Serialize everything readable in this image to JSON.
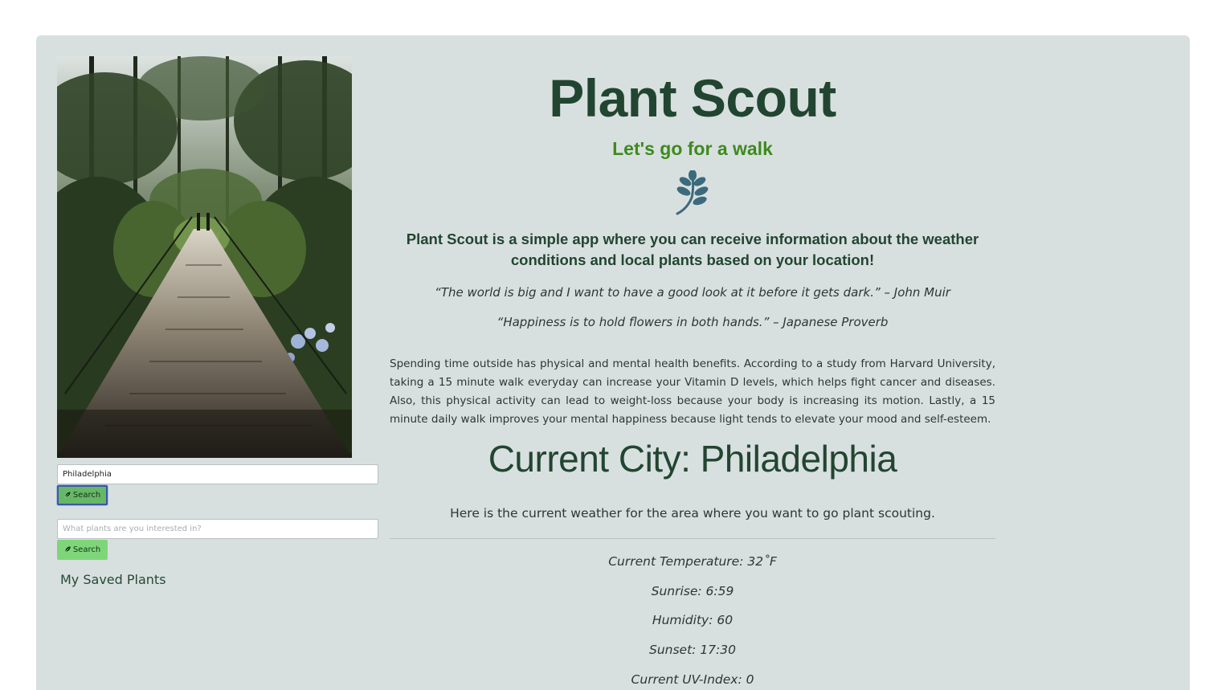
{
  "app": {
    "title": "Plant Scout",
    "tagline": "Let's go for a walk",
    "logo_icon": "leaf-branch-icon",
    "intro": "Plant Scout is a simple app where you can receive information about the weather conditions and local plants based on your location!"
  },
  "quotes": [
    "“The world is big and I want to have a good look at it before it gets dark.” – John Muir",
    "“Happiness is to hold flowers in both hands.” – Japanese Proverb"
  ],
  "health_text": "Spending time outside has physical and mental health benefits. According to a study from Harvard University, taking a 15 minute walk everyday can increase your Vitamin D levels, which helps fight cancer and diseases. Also, this physical activity can lead to weight-loss because your body is increasing its motion. Lastly, a 15 minute daily walk improves your mental happiness because light tends to elevate your mood and self-esteem.",
  "sidebar": {
    "city_search": {
      "value": "Philadelphia",
      "placeholder": "",
      "button_label": "Search",
      "button_icon": "leaf-icon"
    },
    "plant_search": {
      "value": "",
      "placeholder": "What plants are you interested in?",
      "button_label": "Search",
      "button_icon": "leaf-icon"
    },
    "saved_title": "My Saved Plants"
  },
  "weather": {
    "city_heading": "Current City: Philadelphia",
    "intro": "Here is the current weather for the area where you want to go plant scouting.",
    "temperature": "Current Temperature: 32˚F",
    "sunrise": "Sunrise: 6:59",
    "humidity": "Humidity: 60",
    "sunset": "Sunset: 17:30",
    "uv_index": "Current UV-Index: 0"
  },
  "colors": {
    "card_bg": "#d8e0df",
    "title": "#224532",
    "tagline": "#3e8a1e",
    "button": "#7fd67a",
    "logo": "#3b6a7c"
  }
}
